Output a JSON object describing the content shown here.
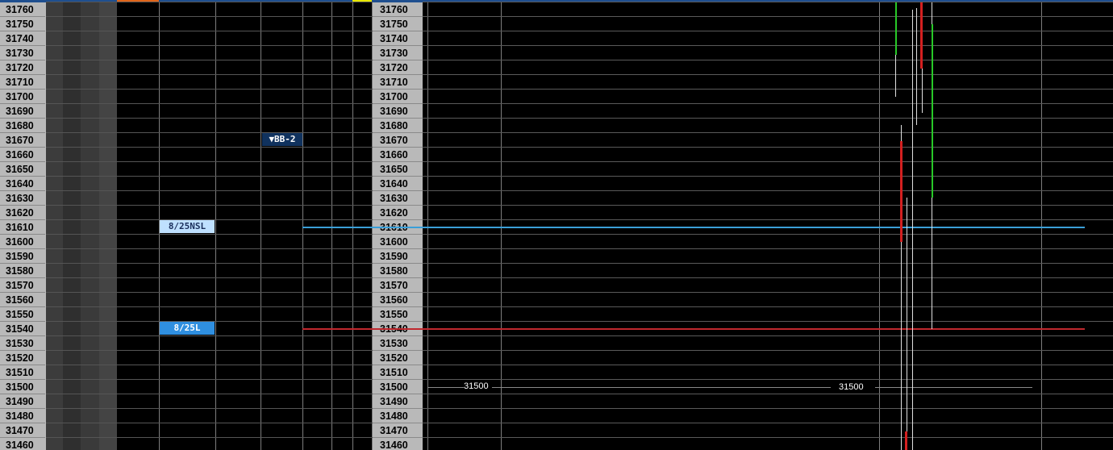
{
  "ladder": {
    "prices": [
      "31760",
      "31750",
      "31740",
      "31730",
      "31720",
      "31710",
      "31700",
      "31690",
      "31680",
      "31670",
      "31660",
      "31650",
      "31640",
      "31630",
      "31620",
      "31610",
      "31600",
      "31590",
      "31580",
      "31570",
      "31560",
      "31550",
      "31540",
      "31530",
      "31520",
      "31510",
      "31500",
      "31490",
      "31480",
      "31470",
      "31460"
    ],
    "orders": {
      "nsl_label": "8/25NSL",
      "l_label": "8/25L",
      "bb_label": "▼BB-2"
    },
    "chart_labels": {
      "left_value": "31500",
      "right_value": "31500",
      "overlap_value": "31500"
    },
    "colors": {
      "price_col": "#b9b9b9",
      "nsl_tag": "#bfe0ff",
      "l_tag": "#2f8fe0",
      "bb_tag": "#10325e",
      "nsl_line": "#3a9fd8",
      "l_line": "#c0282e",
      "candle_up": "#28c828",
      "candle_down": "#d42020"
    }
  }
}
